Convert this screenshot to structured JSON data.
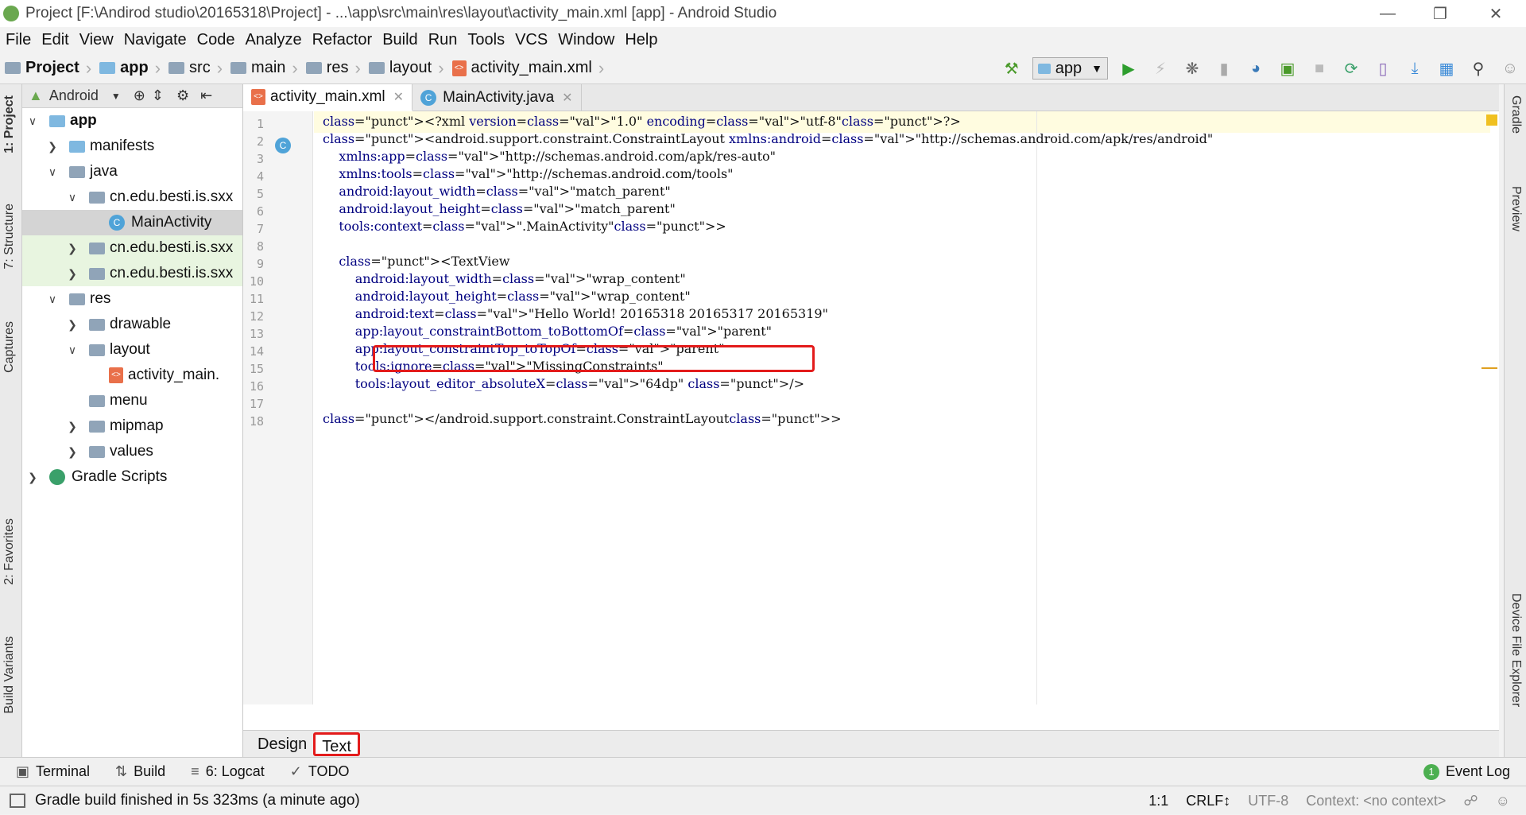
{
  "window": {
    "title": "Project [F:\\Andirod studio\\20165318\\Project] - ...\\app\\src\\main\\res\\layout\\activity_main.xml [app] - Android Studio"
  },
  "menu": [
    "File",
    "Edit",
    "View",
    "Navigate",
    "Code",
    "Analyze",
    "Refactor",
    "Build",
    "Run",
    "Tools",
    "VCS",
    "Window",
    "Help"
  ],
  "breadcrumb": [
    "Project",
    "app",
    "src",
    "main",
    "res",
    "layout",
    "activity_main.xml"
  ],
  "toolbar": {
    "run_config": "app"
  },
  "left_strip": {
    "project": "1: Project",
    "structure": "7: Structure",
    "captures": "Captures",
    "favorites": "2: Favorites",
    "build_variants": "Build Variants"
  },
  "right_strip": {
    "gradle": "Gradle",
    "preview": "Preview",
    "device_explorer": "Device File Explorer"
  },
  "project_panel": {
    "view_mode": "Android",
    "tree": [
      {
        "label": "app",
        "indent": 0,
        "arrow": "down",
        "icon": "folder-blue"
      },
      {
        "label": "manifests",
        "indent": 1,
        "arrow": "right",
        "icon": "folder-blue"
      },
      {
        "label": "java",
        "indent": 1,
        "arrow": "down",
        "icon": "folder"
      },
      {
        "label": "cn.edu.besti.is.sxx",
        "indent": 2,
        "arrow": "down",
        "icon": "folder"
      },
      {
        "label": "MainActivity",
        "indent": 3,
        "arrow": "",
        "icon": "class"
      },
      {
        "label": "cn.edu.besti.is.sxx",
        "indent": 2,
        "arrow": "right",
        "icon": "folder"
      },
      {
        "label": "cn.edu.besti.is.sxx",
        "indent": 2,
        "arrow": "right",
        "icon": "folder"
      },
      {
        "label": "res",
        "indent": 1,
        "arrow": "down",
        "icon": "folder"
      },
      {
        "label": "drawable",
        "indent": 2,
        "arrow": "right",
        "icon": "folder"
      },
      {
        "label": "layout",
        "indent": 2,
        "arrow": "down",
        "icon": "folder"
      },
      {
        "label": "activity_main.",
        "indent": 3,
        "arrow": "",
        "icon": "xml"
      },
      {
        "label": "menu",
        "indent": 2,
        "arrow": "",
        "icon": "folder"
      },
      {
        "label": "mipmap",
        "indent": 2,
        "arrow": "right",
        "icon": "folder"
      },
      {
        "label": "values",
        "indent": 2,
        "arrow": "right",
        "icon": "folder"
      },
      {
        "label": "Gradle Scripts",
        "indent": 0,
        "arrow": "right",
        "icon": "gradle"
      }
    ]
  },
  "editor_tabs": [
    {
      "label": "activity_main.xml",
      "active": true
    },
    {
      "label": "MainActivity.java",
      "active": false
    }
  ],
  "code_lines": [
    "<?xml version=\"1.0\" encoding=\"utf-8\"?>",
    "<android.support.constraint.ConstraintLayout xmlns:android=\"http://schemas.android.com/apk/res/android\"",
    "    xmlns:app=\"http://schemas.android.com/apk/res-auto\"",
    "    xmlns:tools=\"http://schemas.android.com/tools\"",
    "    android:layout_width=\"match_parent\"",
    "    android:layout_height=\"match_parent\"",
    "    tools:context=\".MainActivity\">",
    "",
    "    <TextView",
    "        android:layout_width=\"wrap_content\"",
    "        android:layout_height=\"wrap_content\"",
    "        android:text=\"Hello World! 20165318 20165317 20165319\"",
    "        app:layout_constraintBottom_toBottomOf=\"parent\"",
    "        app:layout_constraintTop_toTopOf=\"parent\"",
    "        tools:ignore=\"MissingConstraints\"",
    "        tools:layout_editor_absoluteX=\"64dp\" />",
    "",
    "</android.support.constraint.ConstraintLayout>"
  ],
  "design_tabs": [
    "Design",
    "Text"
  ],
  "bottom_tools": [
    "Terminal",
    "Build",
    "6: Logcat",
    "TODO"
  ],
  "event_log": {
    "count": "1",
    "label": "Event Log"
  },
  "status": {
    "message": "Gradle build finished in 5s 323ms (a minute ago)",
    "position": "1:1",
    "line_sep": "CRLF↕",
    "encoding": "UTF-8",
    "context": "Context: <no context>"
  }
}
